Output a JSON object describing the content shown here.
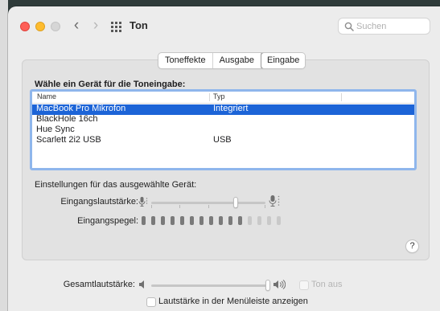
{
  "window": {
    "title": "Ton",
    "search_placeholder": "Suchen"
  },
  "tabs": [
    {
      "label": "Toneffekte",
      "selected": false
    },
    {
      "label": "Ausgabe",
      "selected": false
    },
    {
      "label": "Eingabe",
      "selected": true
    }
  ],
  "input": {
    "heading": "Wähle ein Gerät für die Toneingabe:",
    "columns": {
      "name": "Name",
      "type": "Typ"
    },
    "devices": [
      {
        "name": "MacBook Pro Mikrofon",
        "type": "Integriert",
        "selected": true
      },
      {
        "name": "BlackHole 16ch",
        "type": "",
        "selected": false
      },
      {
        "name": "Hue Sync",
        "type": "",
        "selected": false
      },
      {
        "name": "Scarlett 2i2 USB",
        "type": "USB",
        "selected": false
      }
    ],
    "settings_heading": "Einstellungen für das ausgewählte Gerät:",
    "input_volume_label": "Eingangslautstärke:",
    "input_volume_level": 0.75,
    "input_level_label": "Eingangspegel:",
    "input_level_segments": 15,
    "input_level_active": 11
  },
  "help_label": "?",
  "output": {
    "volume_label": "Gesamtlautstärke:",
    "volume_level": 1.0,
    "mute_label": "Ton aus",
    "mute_checked": false,
    "menubar_label": "Lautstärke in der Menüleiste anzeigen",
    "menubar_checked": false
  },
  "colors": {
    "selection": "#1c64d7",
    "focus_ring": "#8fb6ec",
    "close": "#fe5f57",
    "minimize": "#febc2e"
  }
}
